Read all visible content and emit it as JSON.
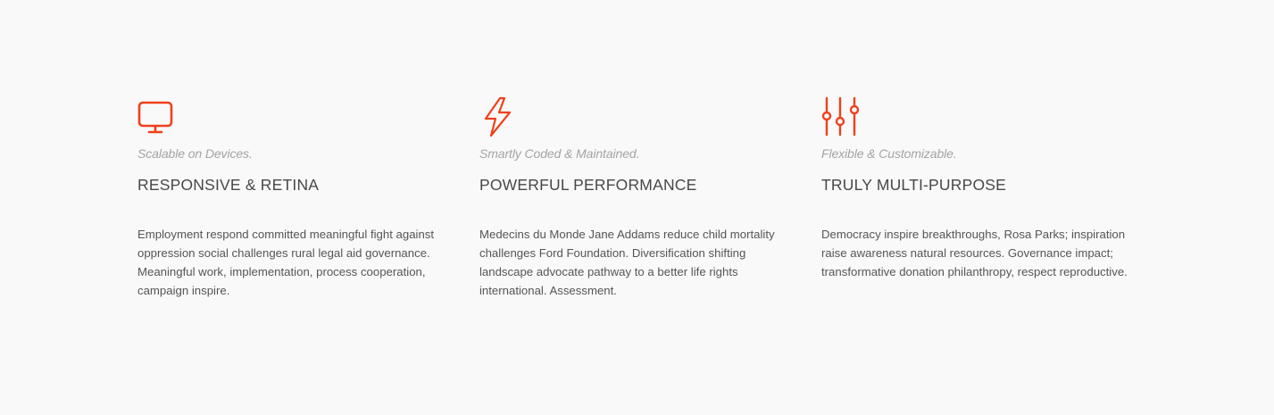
{
  "accent_color": "#f0401b",
  "features": [
    {
      "icon": "monitor-icon",
      "subtitle": "Scalable on Devices.",
      "title": "RESPONSIVE & RETINA",
      "text": "Employment respond committed meaningful fight against oppression social challenges rural legal aid governance. Meaningful work, implementation, process cooperation, campaign inspire."
    },
    {
      "icon": "lightning-icon",
      "subtitle": "Smartly Coded & Maintained.",
      "title": "POWERFUL PERFORMANCE",
      "text": "Medecins du Monde Jane Addams reduce child mortality challenges Ford Foundation. Diversification shifting landscape advocate pathway to a better life rights international. Assessment."
    },
    {
      "icon": "sliders-icon",
      "subtitle": "Flexible & Customizable.",
      "title": "TRULY MULTI-PURPOSE",
      "text": "Democracy inspire breakthroughs, Rosa Parks; inspiration raise awareness natural resources. Governance impact; transformative donation philanthropy, respect reproductive."
    }
  ]
}
